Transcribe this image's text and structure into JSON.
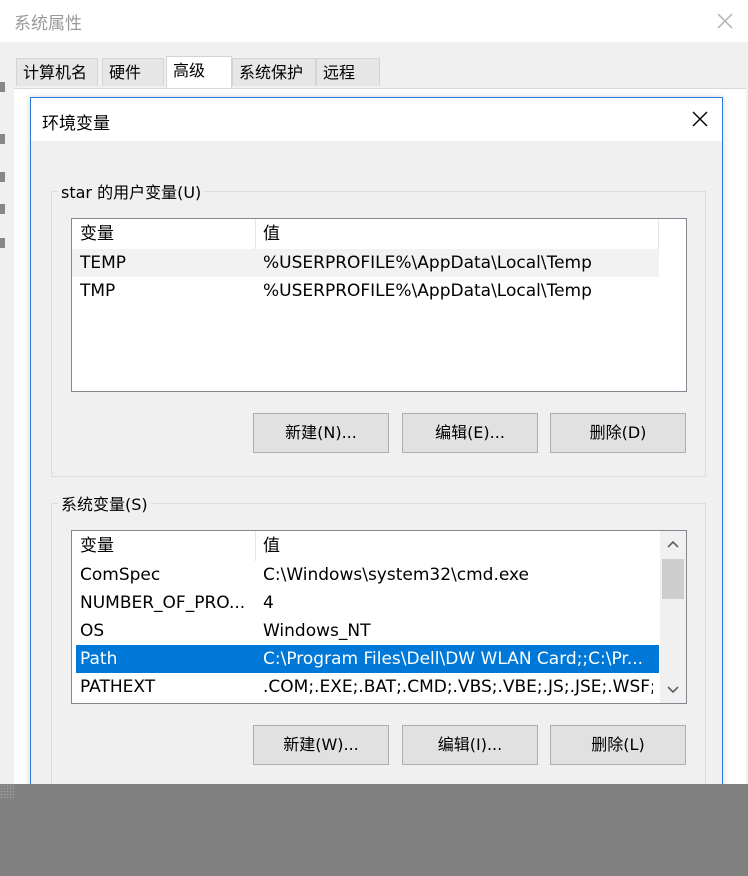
{
  "system_properties": {
    "title": "系统属性",
    "tabs": [
      {
        "label": "计算机名"
      },
      {
        "label": "硬件"
      },
      {
        "label": "高级"
      },
      {
        "label": "系统保护"
      },
      {
        "label": "远程"
      }
    ],
    "active_tab": "高级"
  },
  "env_dialog": {
    "title": "环境变量",
    "user_group": {
      "label": "star 的用户变量(U)",
      "columns": [
        "变量",
        "值"
      ],
      "rows": [
        {
          "name": "TEMP",
          "value": "%USERPROFILE%\\AppData\\Local\\Temp"
        },
        {
          "name": "TMP",
          "value": "%USERPROFILE%\\AppData\\Local\\Temp"
        }
      ],
      "buttons": {
        "new": "新建(N)...",
        "edit": "编辑(E)...",
        "delete": "删除(D)"
      }
    },
    "system_group": {
      "label": "系统变量(S)",
      "columns": [
        "变量",
        "值"
      ],
      "rows": [
        {
          "name": "ComSpec",
          "value": "C:\\Windows\\system32\\cmd.exe"
        },
        {
          "name": "NUMBER_OF_PRO...",
          "value": "4"
        },
        {
          "name": "OS",
          "value": "Windows_NT"
        },
        {
          "name": "Path",
          "value": "C:\\Program Files\\Dell\\DW WLAN Card;;C:\\Pr..."
        },
        {
          "name": "PATHEXT",
          "value": ".COM;.EXE;.BAT;.CMD;.VBS;.VBE;.JS;.JSE;.WSF;...."
        }
      ],
      "selected_row": "Path",
      "buttons": {
        "new": "新建(W)...",
        "edit": "编辑(I)...",
        "delete": "删除(L)"
      }
    }
  },
  "colors": {
    "selection": "#0078d7",
    "dialog_border": "#2b7bd6",
    "overlay": "#808080"
  }
}
